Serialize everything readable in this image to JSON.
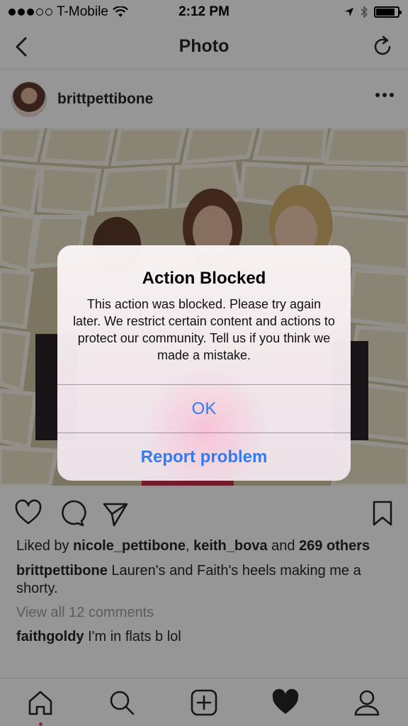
{
  "status_bar": {
    "carrier": "T-Mobile",
    "time": "2:12 PM",
    "signal_bars_filled": 3,
    "signal_bars_total": 5,
    "battery_level": 0.85
  },
  "nav": {
    "title": "Photo",
    "back_icon": "chevron-left-icon",
    "refresh_icon": "refresh-icon"
  },
  "post": {
    "username": "brittpettibone",
    "likes_prefix": "Liked by ",
    "liker_1": "nicole_pettibone",
    "liker_sep": ", ",
    "liker_2": "keith_bova",
    "likes_and": " and ",
    "likes_count": "269 others",
    "caption_user": "brittpettibone",
    "caption_text": " Lauren's and Faith's heels making me a shorty.",
    "view_all_comments": "View all 12 comments",
    "comment_user": "faithgoldy",
    "comment_text": " I'm in flats b lol"
  },
  "alert": {
    "title": "Action Blocked",
    "message": "This action was blocked. Please try again later. We restrict certain content and actions to protect our community. Tell us if you think we made a mistake.",
    "ok_label": "OK",
    "report_label": "Report problem"
  },
  "colors": {
    "ios_blue": "#2f7cf6",
    "notification_dot": "#ed4956",
    "overlay": "rgba(0,0,0,0.4)"
  }
}
